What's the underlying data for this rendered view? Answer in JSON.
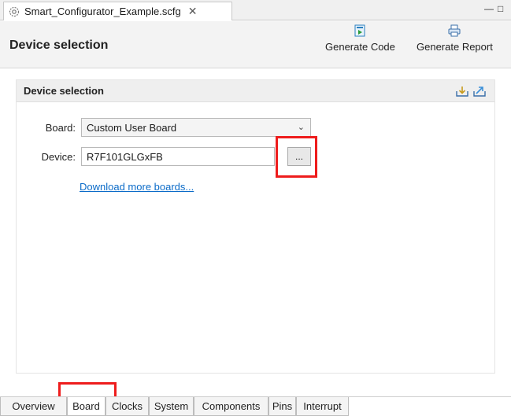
{
  "editor": {
    "tab_title": "Smart_Configurator_Example.scfg",
    "close_glyph": "✕",
    "minimize_glyph": "—",
    "maximize_glyph": "□",
    "tab_icon": "gear-icon"
  },
  "header": {
    "title": "Device selection",
    "generate_code_label": "Generate Code",
    "generate_report_label": "Generate Report"
  },
  "section": {
    "title": "Device selection",
    "board_label": "Board:",
    "board_value": "Custom User Board",
    "device_label": "Device:",
    "device_value": "R7F101GLGxFB",
    "browse_label": "...",
    "download_link": "Download more boards..."
  },
  "bottom_tabs": [
    "Overview",
    "Board",
    "Clocks",
    "System",
    "Components",
    "Pins",
    "Interrupt"
  ],
  "active_tab": "Board",
  "colors": {
    "highlight": "#ee1c1c",
    "link": "#0b6bc8"
  }
}
